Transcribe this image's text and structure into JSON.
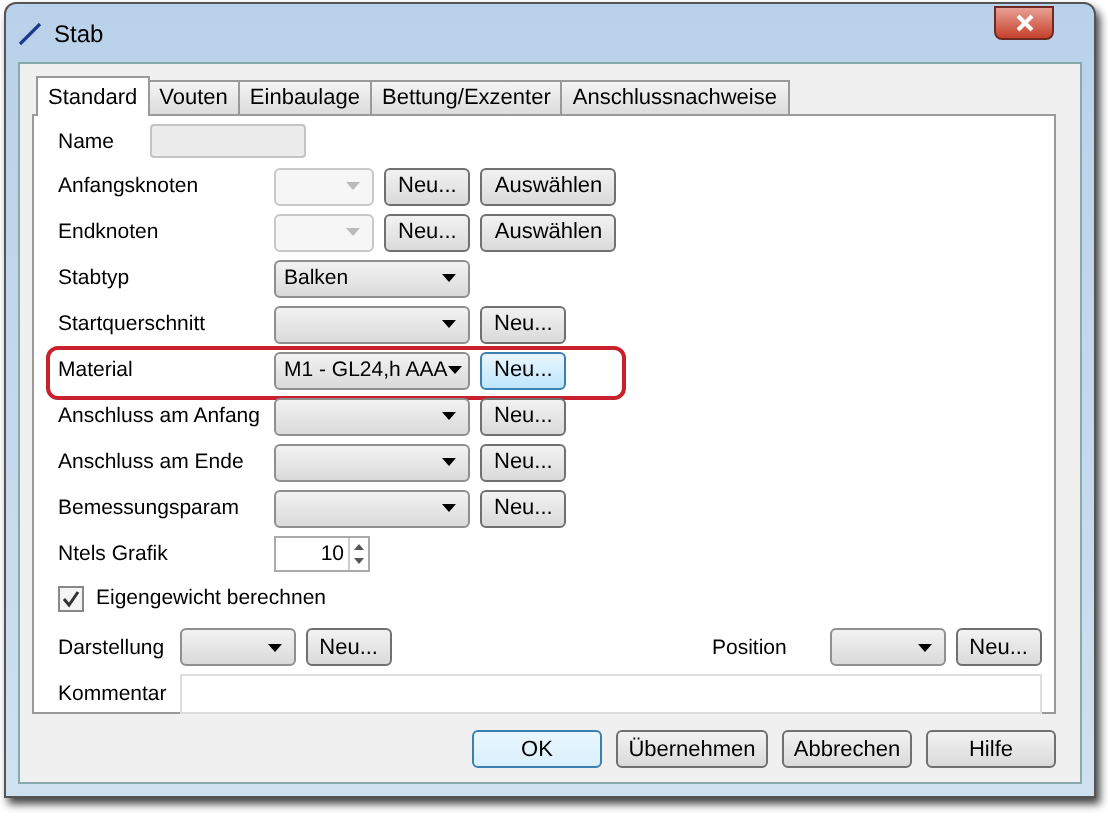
{
  "window": {
    "title": "Stab"
  },
  "tabs": [
    {
      "label": "Standard",
      "selected": true
    },
    {
      "label": "Vouten",
      "selected": false
    },
    {
      "label": "Einbaulage",
      "selected": false
    },
    {
      "label": "Bettung/Exzenter",
      "selected": false
    },
    {
      "label": "Anschlussnachweise",
      "selected": false
    }
  ],
  "rows": [
    {
      "label": "Name",
      "kind": "text",
      "disabled": true
    },
    {
      "label": "Anfangsknoten",
      "kind": "combo",
      "disabled": true,
      "buttons": [
        {
          "label": "Neu...",
          "hovered": false
        },
        {
          "label": "Auswählen",
          "hovered": false
        }
      ]
    },
    {
      "label": "Endknoten",
      "kind": "combo",
      "disabled": true,
      "buttons": [
        {
          "label": "Neu...",
          "hovered": false
        },
        {
          "label": "Auswählen",
          "hovered": false
        }
      ]
    },
    {
      "label": "Stabtyp",
      "kind": "combo",
      "disabled": false,
      "value": "Balken"
    },
    {
      "label": "Startquerschnitt",
      "kind": "combo",
      "disabled": false,
      "buttons": [
        {
          "label": "Neu...",
          "hovered": false
        }
      ]
    },
    {
      "label": "Material",
      "kind": "combo",
      "disabled": false,
      "value": "M1 - GL24,h AAA",
      "highlighted": true,
      "buttons": [
        {
          "label": "Neu...",
          "hovered": true
        }
      ]
    },
    {
      "label": "Anschluss am Anfang",
      "kind": "combo",
      "disabled": false,
      "buttons": [
        {
          "label": "Neu...",
          "hovered": false
        }
      ]
    },
    {
      "label": "Anschluss am Ende",
      "kind": "combo",
      "disabled": false,
      "buttons": [
        {
          "label": "Neu...",
          "hovered": false
        }
      ]
    },
    {
      "label": "Bemessungsparam",
      "kind": "combo",
      "disabled": false,
      "buttons": [
        {
          "label": "Neu...",
          "hovered": false
        }
      ]
    },
    {
      "label": "Ntels Grafik",
      "kind": "spinner",
      "value": "10"
    }
  ],
  "checkbox": {
    "label": "Eigengewicht berechnen",
    "checked": true
  },
  "display_row": [
    {
      "label": "Darstellung",
      "button": "Neu..."
    },
    {
      "label": "Position",
      "button": "Neu..."
    }
  ],
  "comment": {
    "label": "Kommentar"
  },
  "buttons": [
    {
      "label": "OK",
      "default": true
    },
    {
      "label": "Übernehmen",
      "default": false
    },
    {
      "label": "Abbrechen",
      "default": false
    },
    {
      "label": "Hilfe",
      "default": false
    }
  ]
}
